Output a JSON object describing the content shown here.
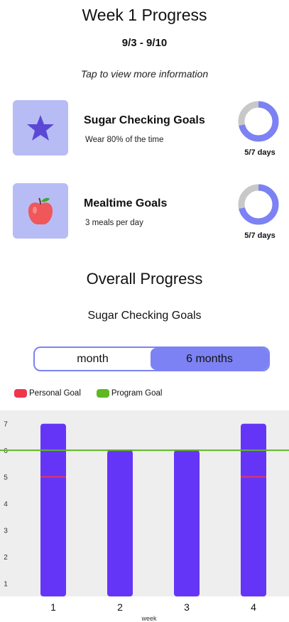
{
  "header": {
    "title": "Week 1 Progress",
    "date_range": "9/3 - 9/10",
    "hint": "Tap to view more information"
  },
  "goals": [
    {
      "name": "Sugar Checking Goals",
      "description": "Wear 80% of the time",
      "icon": "star-icon",
      "progress_label": "5/7 days",
      "progress_fraction": 0.714
    },
    {
      "name": "Mealtime Goals",
      "description": "3 meals per day",
      "icon": "apple-icon",
      "progress_label": "5/7 days",
      "progress_fraction": 0.714
    }
  ],
  "overall": {
    "title": "Overall Progress",
    "subtitle": "Sugar Checking Goals"
  },
  "toggle": {
    "options": [
      "month",
      "6 months"
    ],
    "selected": "6 months"
  },
  "legend": [
    {
      "label": "Personal Goal",
      "color": "#f0344a"
    },
    {
      "label": "Program Goal",
      "color": "#5fb823"
    }
  ],
  "colors": {
    "accent": "#7c82f3",
    "icon_box": "#b8bcf5",
    "ring_track": "#c8c8c8",
    "bar": "#6535f7",
    "chart_bg": "#eeeeee"
  },
  "chart_data": {
    "type": "bar",
    "categories": [
      "1",
      "2",
      "3",
      "4"
    ],
    "values": [
      7,
      6,
      6,
      7
    ],
    "personal_goal": [
      5,
      6,
      6,
      5
    ],
    "program_goal": 6,
    "ylim": [
      0.5,
      7.5
    ],
    "yticks": [
      1,
      2,
      3,
      4,
      5,
      6,
      7
    ],
    "xlabel": "week",
    "ylabel": "",
    "grid": false
  }
}
